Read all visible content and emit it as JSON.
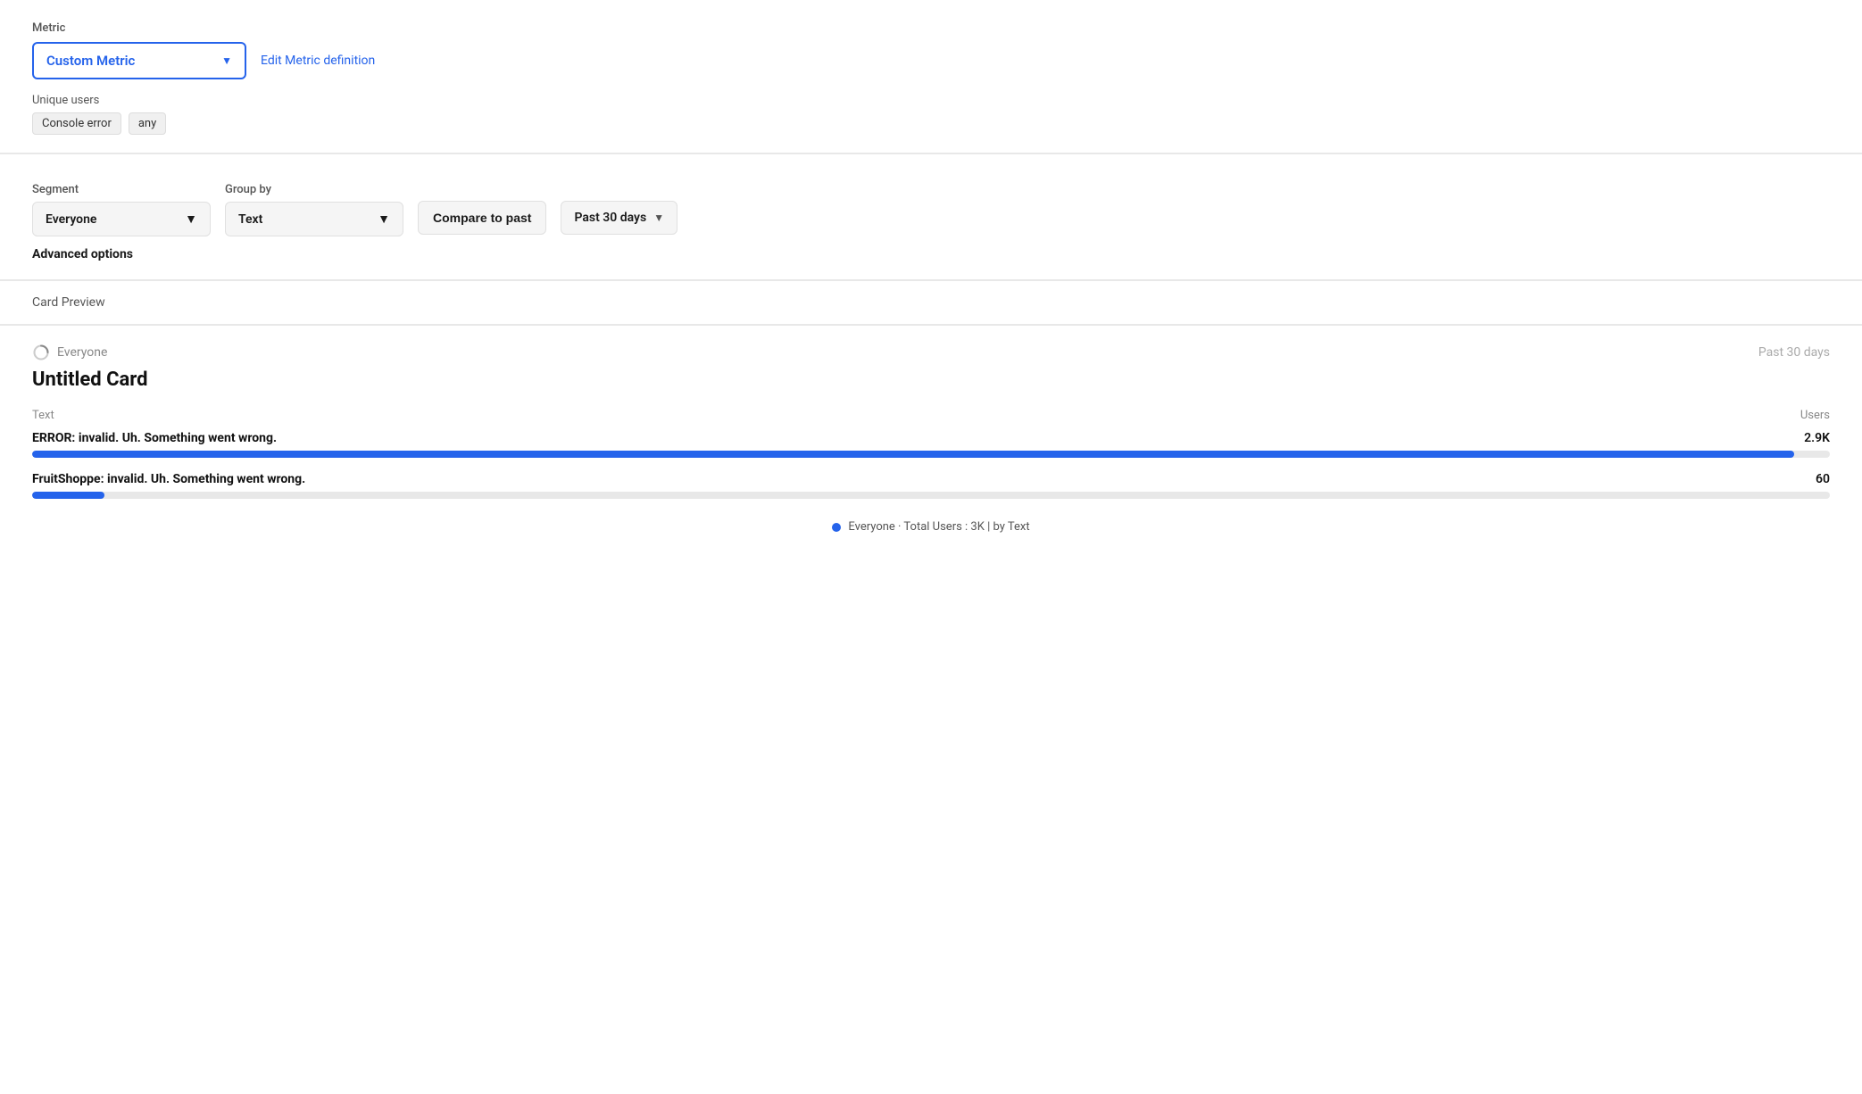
{
  "metric": {
    "label": "Metric",
    "select_text": "Custom Metric",
    "edit_link": "Edit Metric definition"
  },
  "unique_users": {
    "label": "Unique users",
    "tags": [
      "Console error",
      "any"
    ]
  },
  "segment": {
    "label": "Segment",
    "value": "Everyone"
  },
  "group_by": {
    "label": "Group by",
    "value": "Text"
  },
  "compare_btn": "Compare to past",
  "past_days_btn": "Past 30 days",
  "advanced_options": "Advanced options",
  "card_preview": {
    "header": "Card Preview",
    "everyone_label": "Everyone",
    "past_days_label": "Past 30 days",
    "title": "Untitled Card",
    "text_col": "Text",
    "users_col": "Users",
    "items": [
      {
        "label": "ERROR: invalid. Uh. Something went wrong.",
        "value": "2.9K",
        "bar_pct": 98
      },
      {
        "label": "FruitShoppe: invalid. Uh. Something went wrong.",
        "value": "60",
        "bar_pct": 4
      }
    ],
    "legend": "Everyone · Total Users : 3K | by Text"
  }
}
